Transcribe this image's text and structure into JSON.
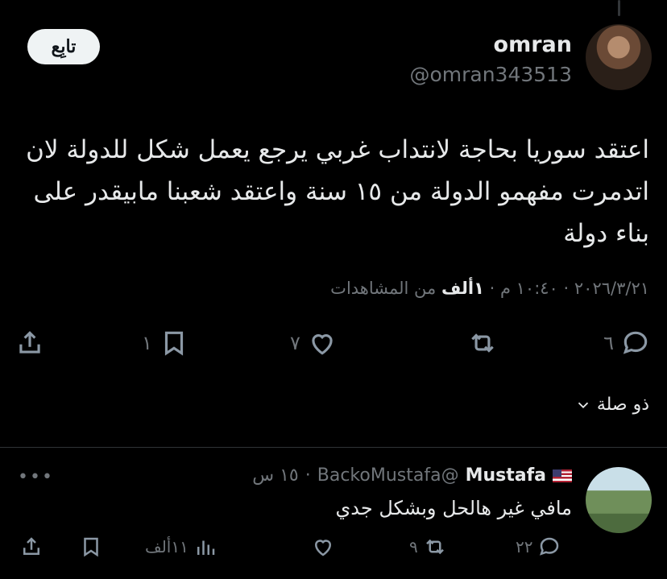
{
  "tweet": {
    "author_name": "omran",
    "author_handle": "@omran343513",
    "follow_label": "تابِع",
    "text": "اعتقد سوريا بحاجة لانتداب غربي يرجع يعمل شكل للدولة لان اتدمرت مفهمو الدولة من ١٥ سنة واعتقد شعبنا مابيقدر على بناء دولة",
    "time": "١٠:٤٠ م",
    "date": "٢٠٢٦/٣/٢١",
    "views_count": "١ألف",
    "views_label": "من المشاهدات",
    "replies_count": "٦",
    "reposts_count": "",
    "likes_count": "٧",
    "bookmarks_count": "١",
    "related_label": "ذو صلة"
  },
  "reply": {
    "name": "Mustafa",
    "handle": "@BackoMustafa",
    "age": "١٥ س",
    "text": "مافي غير هالحل وبشكل جدي",
    "replies_count": "٢٢",
    "reposts_count": "٩",
    "likes_count": "",
    "views_count": "١١ألف"
  },
  "icons": [
    "reply-icon",
    "repost-icon",
    "like-icon",
    "bookmark-icon",
    "share-icon",
    "views-icon",
    "more-icon",
    "chevron-down-icon",
    "us-flag-icon"
  ]
}
